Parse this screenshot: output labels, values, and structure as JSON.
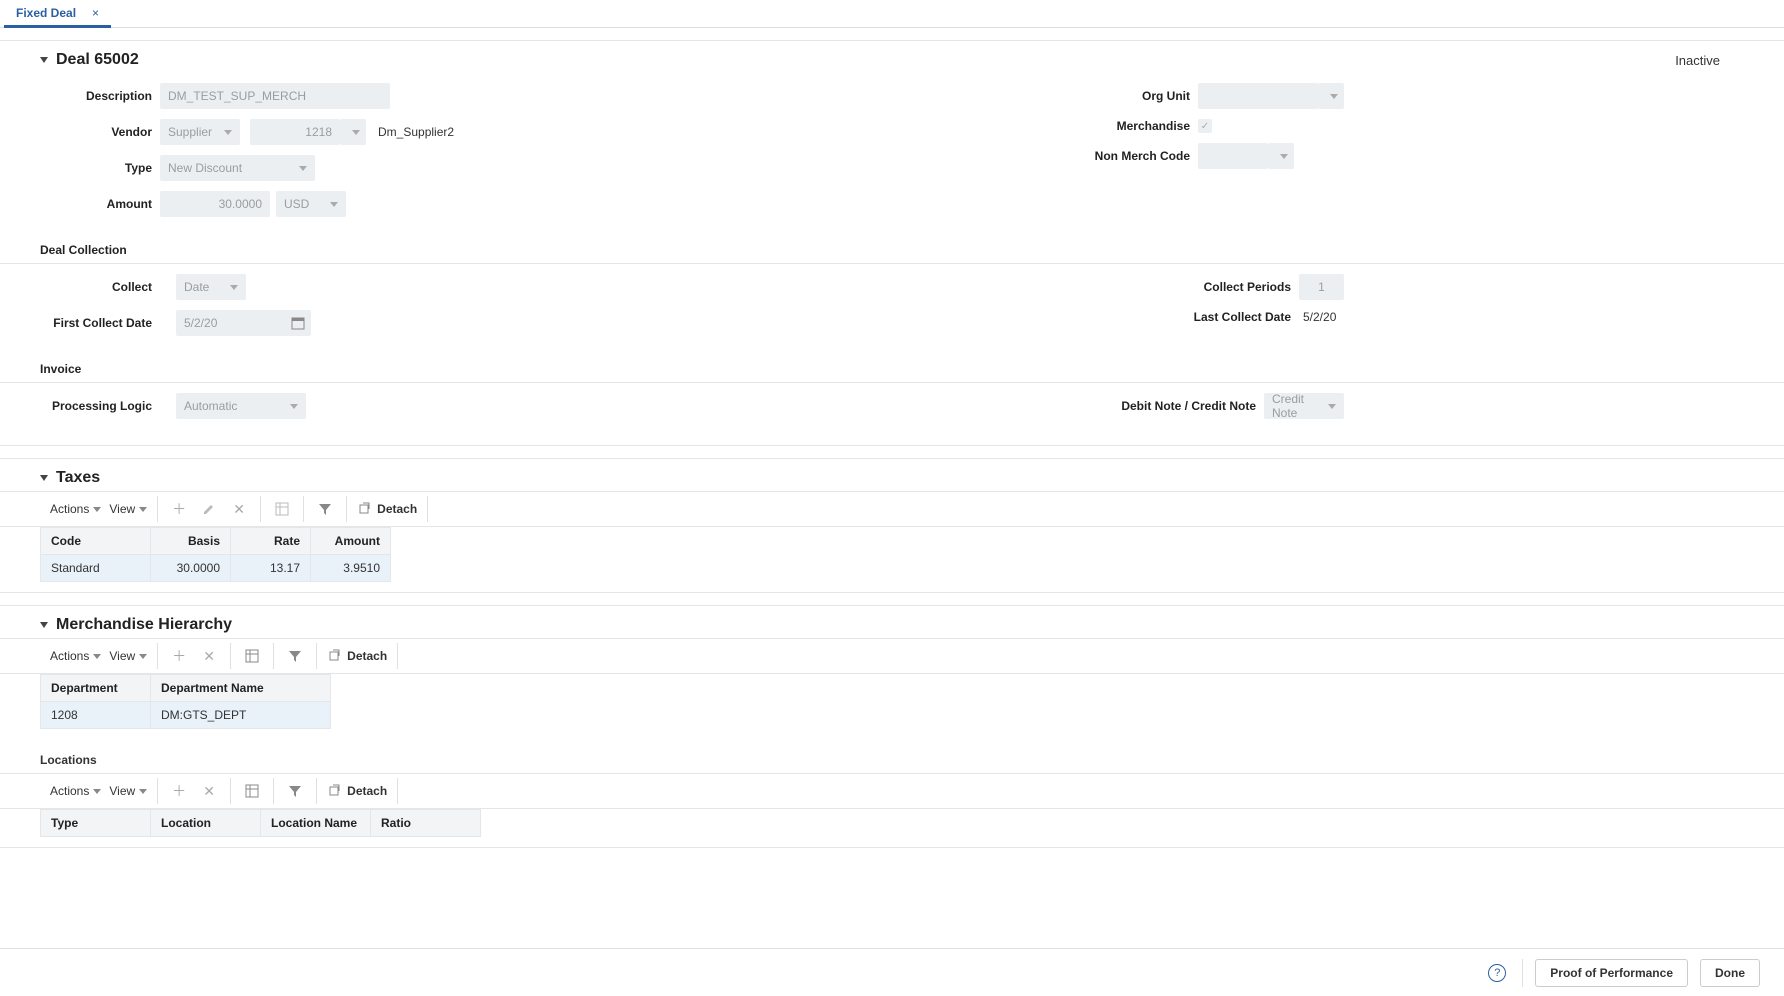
{
  "tab": {
    "title": "Fixed Deal"
  },
  "header": {
    "title": "Deal 65002",
    "status": "Inactive"
  },
  "fields": {
    "description": {
      "label": "Description",
      "value": "DM_TEST_SUP_MERCH"
    },
    "vendor": {
      "label": "Vendor",
      "type": "Supplier",
      "id": "1218",
      "name": "Dm_Supplier2"
    },
    "type": {
      "label": "Type",
      "value": "New Discount"
    },
    "amount": {
      "label": "Amount",
      "value": "30.0000",
      "currency": "USD"
    },
    "org_unit": {
      "label": "Org Unit",
      "value": ""
    },
    "merchandise": {
      "label": "Merchandise",
      "checked": true
    },
    "non_merch_code": {
      "label": "Non Merch Code",
      "value": ""
    }
  },
  "deal_collection": {
    "title": "Deal Collection",
    "collect": {
      "label": "Collect",
      "value": "Date"
    },
    "first_collect_date": {
      "label": "First Collect Date",
      "value": "5/2/20"
    },
    "collect_periods": {
      "label": "Collect Periods",
      "value": "1"
    },
    "last_collect_date": {
      "label": "Last Collect Date",
      "value": "5/2/20"
    }
  },
  "invoice": {
    "title": "Invoice",
    "processing_logic": {
      "label": "Processing Logic",
      "value": "Automatic"
    },
    "note_type": {
      "label": "Debit Note / Credit Note",
      "value": "Credit Note"
    }
  },
  "toolbar": {
    "actions": "Actions",
    "view": "View",
    "detach": "Detach"
  },
  "taxes": {
    "title": "Taxes",
    "cols": {
      "code": "Code",
      "basis": "Basis",
      "rate": "Rate",
      "amount": "Amount"
    },
    "rows": [
      {
        "code": "Standard",
        "basis": "30.0000",
        "rate": "13.17",
        "amount": "3.9510"
      }
    ]
  },
  "merch_hier": {
    "title": "Merchandise Hierarchy",
    "cols": {
      "dept": "Department",
      "dept_name": "Department Name"
    },
    "rows": [
      {
        "dept": "1208",
        "dept_name": "DM:GTS_DEPT"
      }
    ]
  },
  "locations": {
    "title": "Locations",
    "cols": {
      "type": "Type",
      "location": "Location",
      "location_name": "Location Name",
      "ratio": "Ratio"
    }
  },
  "footer": {
    "proof": "Proof of Performance",
    "done": "Done"
  }
}
